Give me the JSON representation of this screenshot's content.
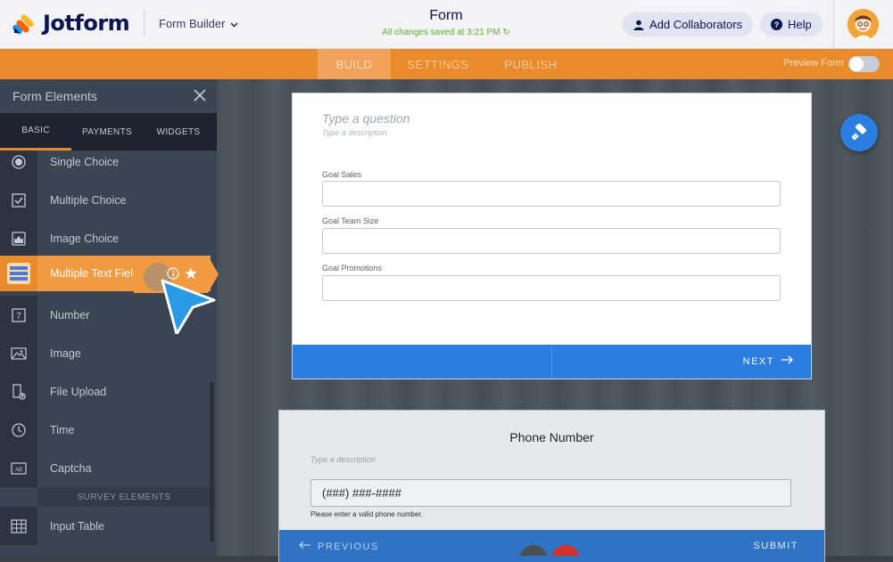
{
  "header": {
    "logo_text": "Jotform",
    "builder_label": "Form Builder",
    "form_title": "Form",
    "saved_text": "All changes saved at 3:21 PM",
    "add_collaborators_label": "Add Collaborators",
    "help_label": "Help"
  },
  "nav": {
    "tabs": [
      {
        "label": "BUILD",
        "active": true
      },
      {
        "label": "SETTINGS",
        "active": false
      },
      {
        "label": "PUBLISH",
        "active": false
      }
    ],
    "preview_label": "Preview Form"
  },
  "sidebar": {
    "title": "Form Elements",
    "tabs": [
      {
        "label": "BASIC",
        "active": true
      },
      {
        "label": "PAYMENTS",
        "active": false
      },
      {
        "label": "WIDGETS",
        "active": false
      }
    ],
    "items": [
      {
        "label": "Single Choice",
        "icon": "radio-icon"
      },
      {
        "label": "Multiple Choice",
        "icon": "checkbox-icon"
      },
      {
        "label": "Image Choice",
        "icon": "image-choice-icon"
      },
      {
        "label": "Multiple Text Fields",
        "icon": "multiple-text-fields-icon",
        "highlighted": true
      },
      {
        "label": "Number",
        "icon": "number-icon"
      },
      {
        "label": "Image",
        "icon": "image-icon"
      },
      {
        "label": "File Upload",
        "icon": "file-upload-icon"
      },
      {
        "label": "Time",
        "icon": "clock-icon"
      },
      {
        "label": "Captcha",
        "icon": "captcha-icon"
      }
    ],
    "section_label": "SURVEY ELEMENTS",
    "survey_items": [
      {
        "label": "Input Table",
        "icon": "table-icon"
      }
    ]
  },
  "card1": {
    "question_placeholder": "Type a question",
    "description_placeholder": "Type a description",
    "fields": [
      {
        "label": "Goal Sales",
        "value": ""
      },
      {
        "label": "Goal Team Size",
        "value": ""
      },
      {
        "label": "Goal Promotions",
        "value": ""
      }
    ],
    "next_label": "NEXT"
  },
  "card2": {
    "title": "Phone Number",
    "description_placeholder": "Type a description",
    "input_value": "(###) ###-####",
    "hint": "Please enter a valid phone number.",
    "previous_label": "PREVIOUS",
    "submit_label": "SUBMIT"
  },
  "colors": {
    "accent_orange": "#e98a2c",
    "primary_blue": "#2b7de0",
    "sidebar_bg": "#3b4452",
    "saved_green": "#62b234"
  }
}
